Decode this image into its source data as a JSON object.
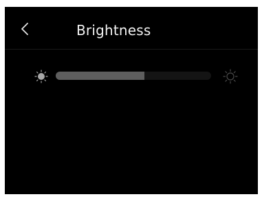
{
  "header": {
    "title": "Brightness",
    "back_icon": "chevron-left-icon"
  },
  "brightness": {
    "level_fraction": 0.57,
    "min_icon": "sun-small-icon",
    "max_icon": "sun-large-icon"
  },
  "colors": {
    "background": "#000000",
    "slider_fill": "#5e5e5e",
    "slider_track": "#141414",
    "text": "#f2f2f2"
  }
}
